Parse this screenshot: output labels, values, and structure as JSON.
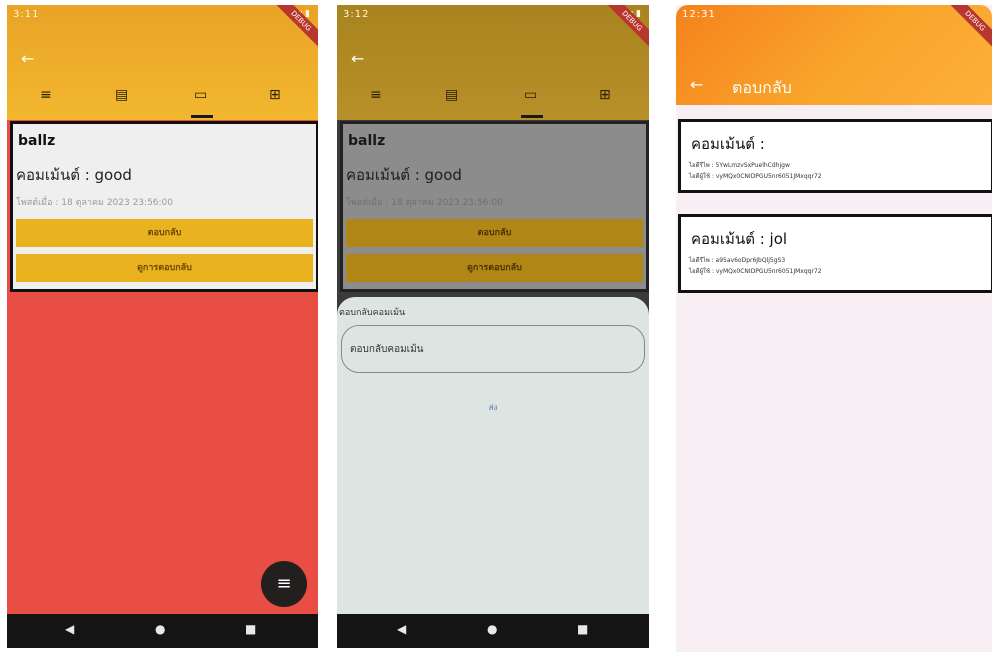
{
  "phone1": {
    "status_time": "3:11",
    "debug_label": "DEBUG",
    "back_icon": "arrow-left-icon",
    "tabs": [
      {
        "name": "list",
        "icon": "≡"
      },
      {
        "name": "book",
        "icon": "▤"
      },
      {
        "name": "comment",
        "icon": "▭"
      },
      {
        "name": "add-comment",
        "icon": "⊞"
      }
    ],
    "card": {
      "name": "ballz",
      "comment": "คอมเม้นต์ : good",
      "time": "โพสต์เมื่อ : 18 ตุลาคม 2023 23:56:00",
      "reply_label": "ตอบกลับ",
      "view_replies_label": "ดูการตอบกลับ"
    },
    "fab_icon": "≡"
  },
  "phone2": {
    "status_time": "3:12",
    "debug_label": "DEBUG",
    "card": {
      "name": "ballz",
      "comment": "คอมเม้นต์ : good",
      "time": "โพสต์เมื่อ : 18 ตุลาคม 2023 23:56:00",
      "reply_label": "ตอบกลับ",
      "view_replies_label": "ดูการตอบกลับ"
    },
    "sheet": {
      "title": "ตอบกลับคอมเม้น",
      "input_placeholder": "ตอบกลับคอมเม้น",
      "send_label": "ส่ง"
    }
  },
  "phone3": {
    "status_time": "12:31",
    "debug_label": "DEBUG",
    "title": "ตอบกลับ",
    "replies": [
      {
        "comment": "คอมเม้นต์ :",
        "reply_id": "ไอดีรีไพ : 5YwLmzvSxPuelhCdhjgw",
        "user_id": "ไอดีผู้ใช้ : vyMQx0CNIDPGU5nr6051JMxqqr72"
      },
      {
        "comment": "คอมเม้นต์ : jol",
        "reply_id": "ไอดีรีไพ : a95av6oDpr6JbQlj5gS3",
        "user_id": "ไอดีผู้ใช้ : vyMQx0CNIDPGU5nr6051JMxqqr72"
      }
    ]
  },
  "nav": {
    "back": "◀",
    "home": "●",
    "recents": "■"
  }
}
